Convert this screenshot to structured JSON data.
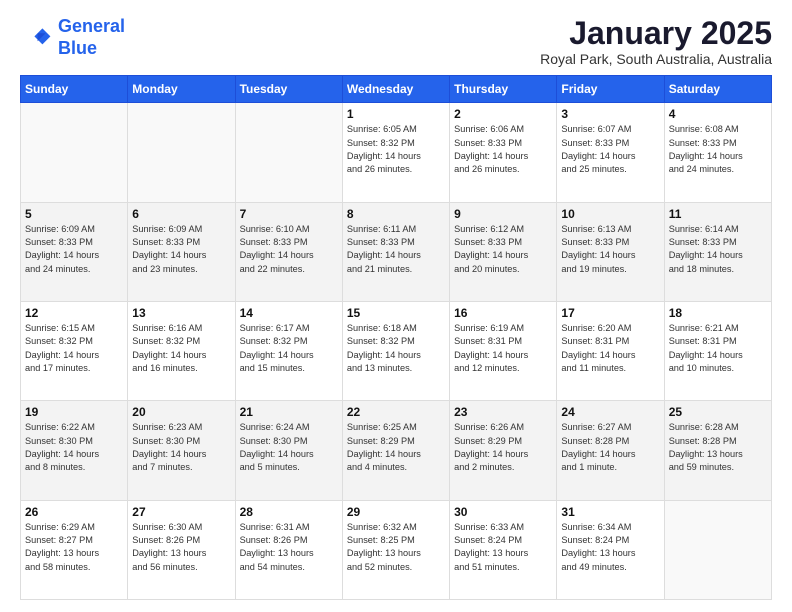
{
  "header": {
    "logo_line1": "General",
    "logo_line2": "Blue",
    "month": "January 2025",
    "location": "Royal Park, South Australia, Australia"
  },
  "days_of_week": [
    "Sunday",
    "Monday",
    "Tuesday",
    "Wednesday",
    "Thursday",
    "Friday",
    "Saturday"
  ],
  "weeks": [
    [
      {
        "day": "",
        "info": ""
      },
      {
        "day": "",
        "info": ""
      },
      {
        "day": "",
        "info": ""
      },
      {
        "day": "1",
        "info": "Sunrise: 6:05 AM\nSunset: 8:32 PM\nDaylight: 14 hours\nand 26 minutes."
      },
      {
        "day": "2",
        "info": "Sunrise: 6:06 AM\nSunset: 8:33 PM\nDaylight: 14 hours\nand 26 minutes."
      },
      {
        "day": "3",
        "info": "Sunrise: 6:07 AM\nSunset: 8:33 PM\nDaylight: 14 hours\nand 25 minutes."
      },
      {
        "day": "4",
        "info": "Sunrise: 6:08 AM\nSunset: 8:33 PM\nDaylight: 14 hours\nand 24 minutes."
      }
    ],
    [
      {
        "day": "5",
        "info": "Sunrise: 6:09 AM\nSunset: 8:33 PM\nDaylight: 14 hours\nand 24 minutes."
      },
      {
        "day": "6",
        "info": "Sunrise: 6:09 AM\nSunset: 8:33 PM\nDaylight: 14 hours\nand 23 minutes."
      },
      {
        "day": "7",
        "info": "Sunrise: 6:10 AM\nSunset: 8:33 PM\nDaylight: 14 hours\nand 22 minutes."
      },
      {
        "day": "8",
        "info": "Sunrise: 6:11 AM\nSunset: 8:33 PM\nDaylight: 14 hours\nand 21 minutes."
      },
      {
        "day": "9",
        "info": "Sunrise: 6:12 AM\nSunset: 8:33 PM\nDaylight: 14 hours\nand 20 minutes."
      },
      {
        "day": "10",
        "info": "Sunrise: 6:13 AM\nSunset: 8:33 PM\nDaylight: 14 hours\nand 19 minutes."
      },
      {
        "day": "11",
        "info": "Sunrise: 6:14 AM\nSunset: 8:33 PM\nDaylight: 14 hours\nand 18 minutes."
      }
    ],
    [
      {
        "day": "12",
        "info": "Sunrise: 6:15 AM\nSunset: 8:32 PM\nDaylight: 14 hours\nand 17 minutes."
      },
      {
        "day": "13",
        "info": "Sunrise: 6:16 AM\nSunset: 8:32 PM\nDaylight: 14 hours\nand 16 minutes."
      },
      {
        "day": "14",
        "info": "Sunrise: 6:17 AM\nSunset: 8:32 PM\nDaylight: 14 hours\nand 15 minutes."
      },
      {
        "day": "15",
        "info": "Sunrise: 6:18 AM\nSunset: 8:32 PM\nDaylight: 14 hours\nand 13 minutes."
      },
      {
        "day": "16",
        "info": "Sunrise: 6:19 AM\nSunset: 8:31 PM\nDaylight: 14 hours\nand 12 minutes."
      },
      {
        "day": "17",
        "info": "Sunrise: 6:20 AM\nSunset: 8:31 PM\nDaylight: 14 hours\nand 11 minutes."
      },
      {
        "day": "18",
        "info": "Sunrise: 6:21 AM\nSunset: 8:31 PM\nDaylight: 14 hours\nand 10 minutes."
      }
    ],
    [
      {
        "day": "19",
        "info": "Sunrise: 6:22 AM\nSunset: 8:30 PM\nDaylight: 14 hours\nand 8 minutes."
      },
      {
        "day": "20",
        "info": "Sunrise: 6:23 AM\nSunset: 8:30 PM\nDaylight: 14 hours\nand 7 minutes."
      },
      {
        "day": "21",
        "info": "Sunrise: 6:24 AM\nSunset: 8:30 PM\nDaylight: 14 hours\nand 5 minutes."
      },
      {
        "day": "22",
        "info": "Sunrise: 6:25 AM\nSunset: 8:29 PM\nDaylight: 14 hours\nand 4 minutes."
      },
      {
        "day": "23",
        "info": "Sunrise: 6:26 AM\nSunset: 8:29 PM\nDaylight: 14 hours\nand 2 minutes."
      },
      {
        "day": "24",
        "info": "Sunrise: 6:27 AM\nSunset: 8:28 PM\nDaylight: 14 hours\nand 1 minute."
      },
      {
        "day": "25",
        "info": "Sunrise: 6:28 AM\nSunset: 8:28 PM\nDaylight: 13 hours\nand 59 minutes."
      }
    ],
    [
      {
        "day": "26",
        "info": "Sunrise: 6:29 AM\nSunset: 8:27 PM\nDaylight: 13 hours\nand 58 minutes."
      },
      {
        "day": "27",
        "info": "Sunrise: 6:30 AM\nSunset: 8:26 PM\nDaylight: 13 hours\nand 56 minutes."
      },
      {
        "day": "28",
        "info": "Sunrise: 6:31 AM\nSunset: 8:26 PM\nDaylight: 13 hours\nand 54 minutes."
      },
      {
        "day": "29",
        "info": "Sunrise: 6:32 AM\nSunset: 8:25 PM\nDaylight: 13 hours\nand 52 minutes."
      },
      {
        "day": "30",
        "info": "Sunrise: 6:33 AM\nSunset: 8:24 PM\nDaylight: 13 hours\nand 51 minutes."
      },
      {
        "day": "31",
        "info": "Sunrise: 6:34 AM\nSunset: 8:24 PM\nDaylight: 13 hours\nand 49 minutes."
      },
      {
        "day": "",
        "info": ""
      }
    ]
  ]
}
